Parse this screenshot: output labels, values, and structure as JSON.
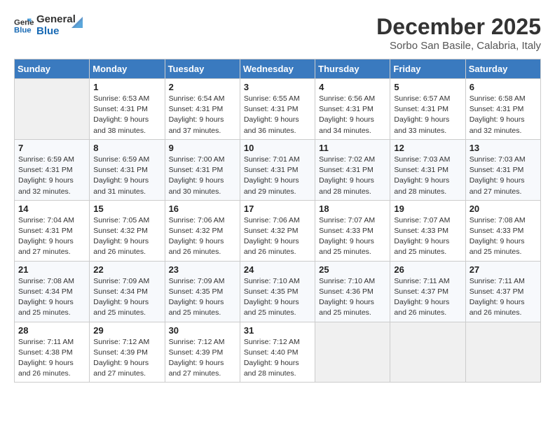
{
  "header": {
    "logo_line1": "General",
    "logo_line2": "Blue",
    "month_title": "December 2025",
    "subtitle": "Sorbo San Basile, Calabria, Italy"
  },
  "days_of_week": [
    "Sunday",
    "Monday",
    "Tuesday",
    "Wednesday",
    "Thursday",
    "Friday",
    "Saturday"
  ],
  "weeks": [
    [
      {
        "day": "",
        "info": ""
      },
      {
        "day": "1",
        "info": "Sunrise: 6:53 AM\nSunset: 4:31 PM\nDaylight: 9 hours\nand 38 minutes."
      },
      {
        "day": "2",
        "info": "Sunrise: 6:54 AM\nSunset: 4:31 PM\nDaylight: 9 hours\nand 37 minutes."
      },
      {
        "day": "3",
        "info": "Sunrise: 6:55 AM\nSunset: 4:31 PM\nDaylight: 9 hours\nand 36 minutes."
      },
      {
        "day": "4",
        "info": "Sunrise: 6:56 AM\nSunset: 4:31 PM\nDaylight: 9 hours\nand 34 minutes."
      },
      {
        "day": "5",
        "info": "Sunrise: 6:57 AM\nSunset: 4:31 PM\nDaylight: 9 hours\nand 33 minutes."
      },
      {
        "day": "6",
        "info": "Sunrise: 6:58 AM\nSunset: 4:31 PM\nDaylight: 9 hours\nand 32 minutes."
      }
    ],
    [
      {
        "day": "7",
        "info": "Sunrise: 6:59 AM\nSunset: 4:31 PM\nDaylight: 9 hours\nand 32 minutes."
      },
      {
        "day": "8",
        "info": "Sunrise: 6:59 AM\nSunset: 4:31 PM\nDaylight: 9 hours\nand 31 minutes."
      },
      {
        "day": "9",
        "info": "Sunrise: 7:00 AM\nSunset: 4:31 PM\nDaylight: 9 hours\nand 30 minutes."
      },
      {
        "day": "10",
        "info": "Sunrise: 7:01 AM\nSunset: 4:31 PM\nDaylight: 9 hours\nand 29 minutes."
      },
      {
        "day": "11",
        "info": "Sunrise: 7:02 AM\nSunset: 4:31 PM\nDaylight: 9 hours\nand 28 minutes."
      },
      {
        "day": "12",
        "info": "Sunrise: 7:03 AM\nSunset: 4:31 PM\nDaylight: 9 hours\nand 28 minutes."
      },
      {
        "day": "13",
        "info": "Sunrise: 7:03 AM\nSunset: 4:31 PM\nDaylight: 9 hours\nand 27 minutes."
      }
    ],
    [
      {
        "day": "14",
        "info": "Sunrise: 7:04 AM\nSunset: 4:31 PM\nDaylight: 9 hours\nand 27 minutes."
      },
      {
        "day": "15",
        "info": "Sunrise: 7:05 AM\nSunset: 4:32 PM\nDaylight: 9 hours\nand 26 minutes."
      },
      {
        "day": "16",
        "info": "Sunrise: 7:06 AM\nSunset: 4:32 PM\nDaylight: 9 hours\nand 26 minutes."
      },
      {
        "day": "17",
        "info": "Sunrise: 7:06 AM\nSunset: 4:32 PM\nDaylight: 9 hours\nand 26 minutes."
      },
      {
        "day": "18",
        "info": "Sunrise: 7:07 AM\nSunset: 4:33 PM\nDaylight: 9 hours\nand 25 minutes."
      },
      {
        "day": "19",
        "info": "Sunrise: 7:07 AM\nSunset: 4:33 PM\nDaylight: 9 hours\nand 25 minutes."
      },
      {
        "day": "20",
        "info": "Sunrise: 7:08 AM\nSunset: 4:33 PM\nDaylight: 9 hours\nand 25 minutes."
      }
    ],
    [
      {
        "day": "21",
        "info": "Sunrise: 7:08 AM\nSunset: 4:34 PM\nDaylight: 9 hours\nand 25 minutes."
      },
      {
        "day": "22",
        "info": "Sunrise: 7:09 AM\nSunset: 4:34 PM\nDaylight: 9 hours\nand 25 minutes."
      },
      {
        "day": "23",
        "info": "Sunrise: 7:09 AM\nSunset: 4:35 PM\nDaylight: 9 hours\nand 25 minutes."
      },
      {
        "day": "24",
        "info": "Sunrise: 7:10 AM\nSunset: 4:35 PM\nDaylight: 9 hours\nand 25 minutes."
      },
      {
        "day": "25",
        "info": "Sunrise: 7:10 AM\nSunset: 4:36 PM\nDaylight: 9 hours\nand 25 minutes."
      },
      {
        "day": "26",
        "info": "Sunrise: 7:11 AM\nSunset: 4:37 PM\nDaylight: 9 hours\nand 26 minutes."
      },
      {
        "day": "27",
        "info": "Sunrise: 7:11 AM\nSunset: 4:37 PM\nDaylight: 9 hours\nand 26 minutes."
      }
    ],
    [
      {
        "day": "28",
        "info": "Sunrise: 7:11 AM\nSunset: 4:38 PM\nDaylight: 9 hours\nand 26 minutes."
      },
      {
        "day": "29",
        "info": "Sunrise: 7:12 AM\nSunset: 4:39 PM\nDaylight: 9 hours\nand 27 minutes."
      },
      {
        "day": "30",
        "info": "Sunrise: 7:12 AM\nSunset: 4:39 PM\nDaylight: 9 hours\nand 27 minutes."
      },
      {
        "day": "31",
        "info": "Sunrise: 7:12 AM\nSunset: 4:40 PM\nDaylight: 9 hours\nand 28 minutes."
      },
      {
        "day": "",
        "info": ""
      },
      {
        "day": "",
        "info": ""
      },
      {
        "day": "",
        "info": ""
      }
    ]
  ]
}
